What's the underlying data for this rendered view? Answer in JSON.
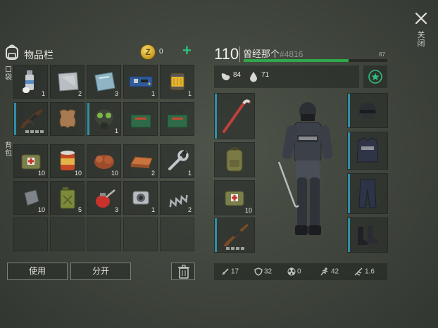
{
  "close": {
    "label": "关闭"
  },
  "inventory": {
    "title": "物品栏",
    "coins": "0",
    "pocket_label": "口袋",
    "backpack_label": "背包",
    "slots": {
      "s0": "1",
      "s1": "2",
      "s2": "3",
      "s3": "1",
      "s4": "1",
      "s7": "1",
      "s10": "10",
      "s11": "10",
      "s12": "10",
      "s13": "2",
      "s14": "1",
      "s15": "10",
      "s16": "5",
      "s17": "3",
      "s18": "1",
      "s19": "2"
    }
  },
  "buttons": {
    "use": "使用",
    "split": "分开"
  },
  "character": {
    "level": "110",
    "name": "曾经那个",
    "id": "#4816",
    "health_value": "87",
    "health_fraction": 0.73,
    "food": "84",
    "water": "71"
  },
  "equipment": {
    "bandage_qty": "10"
  },
  "stats": {
    "attack": "17",
    "defense": "32",
    "radiation": "0",
    "speed": "42",
    "other": "1.6"
  },
  "colors": {
    "accent_teal": "#2f8fa6",
    "health_green": "#2fa84c",
    "coin_gold": "#d8aa2a",
    "plus_green": "#2fbf7c"
  }
}
